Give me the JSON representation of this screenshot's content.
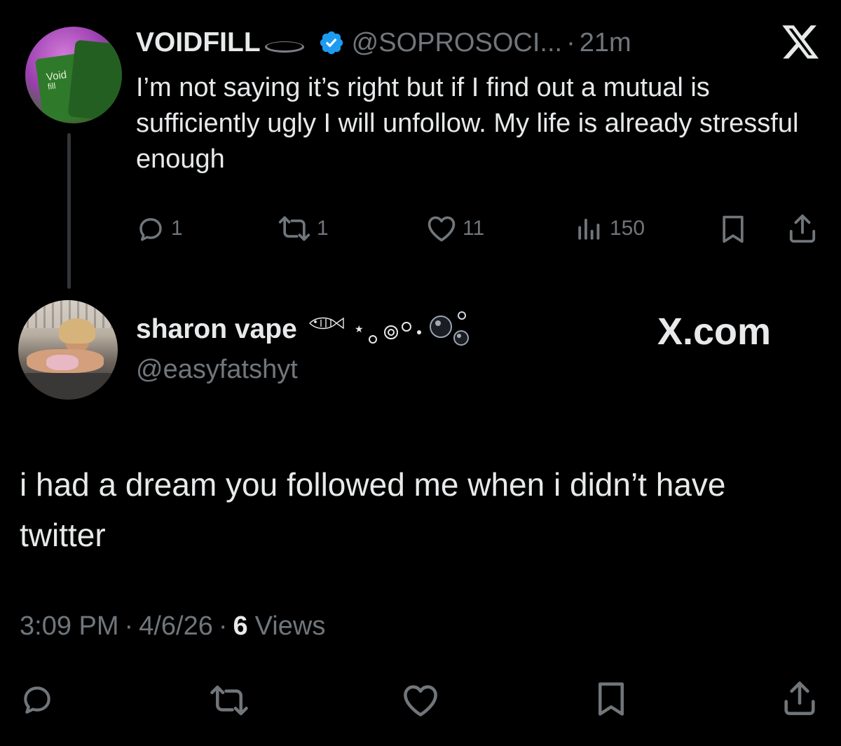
{
  "quoted": {
    "name": "VOIDFILL",
    "handle": "@SOPROSOCI...",
    "separator": "·",
    "time": "21m",
    "avatar_label_line1": "Void",
    "avatar_label_line2": "fill",
    "text": "I’m not saying it’s right but if I find out a mutual is sufficiently ugly I will unfollow. My life is already stressful enough",
    "stats": {
      "replies": "1",
      "reposts": "1",
      "likes": "11",
      "views": "150"
    },
    "icons": [
      "x-logo-icon",
      "verified-badge-icon",
      "reply-icon",
      "repost-icon",
      "like-icon",
      "views-icon",
      "bookmark-icon",
      "share-icon"
    ]
  },
  "reply": {
    "name": "sharon vape",
    "handle": "@easyfatshyt",
    "text": "i had a dream you followed me when i didn’t have twitter",
    "watermark": "X.com",
    "meta": {
      "time": "3:09 PM",
      "dot1": "·",
      "date": "4/6/26",
      "dot2": "·",
      "views_count": "6",
      "views_label": "Views"
    },
    "icons": [
      "reply-icon",
      "repost-icon",
      "like-icon",
      "bookmark-icon",
      "share-icon"
    ]
  },
  "colors": {
    "background": "#000000",
    "text": "#e7e9ea",
    "muted": "#71767b",
    "verified": "#1d9bf0",
    "thread_line": "#333639"
  }
}
